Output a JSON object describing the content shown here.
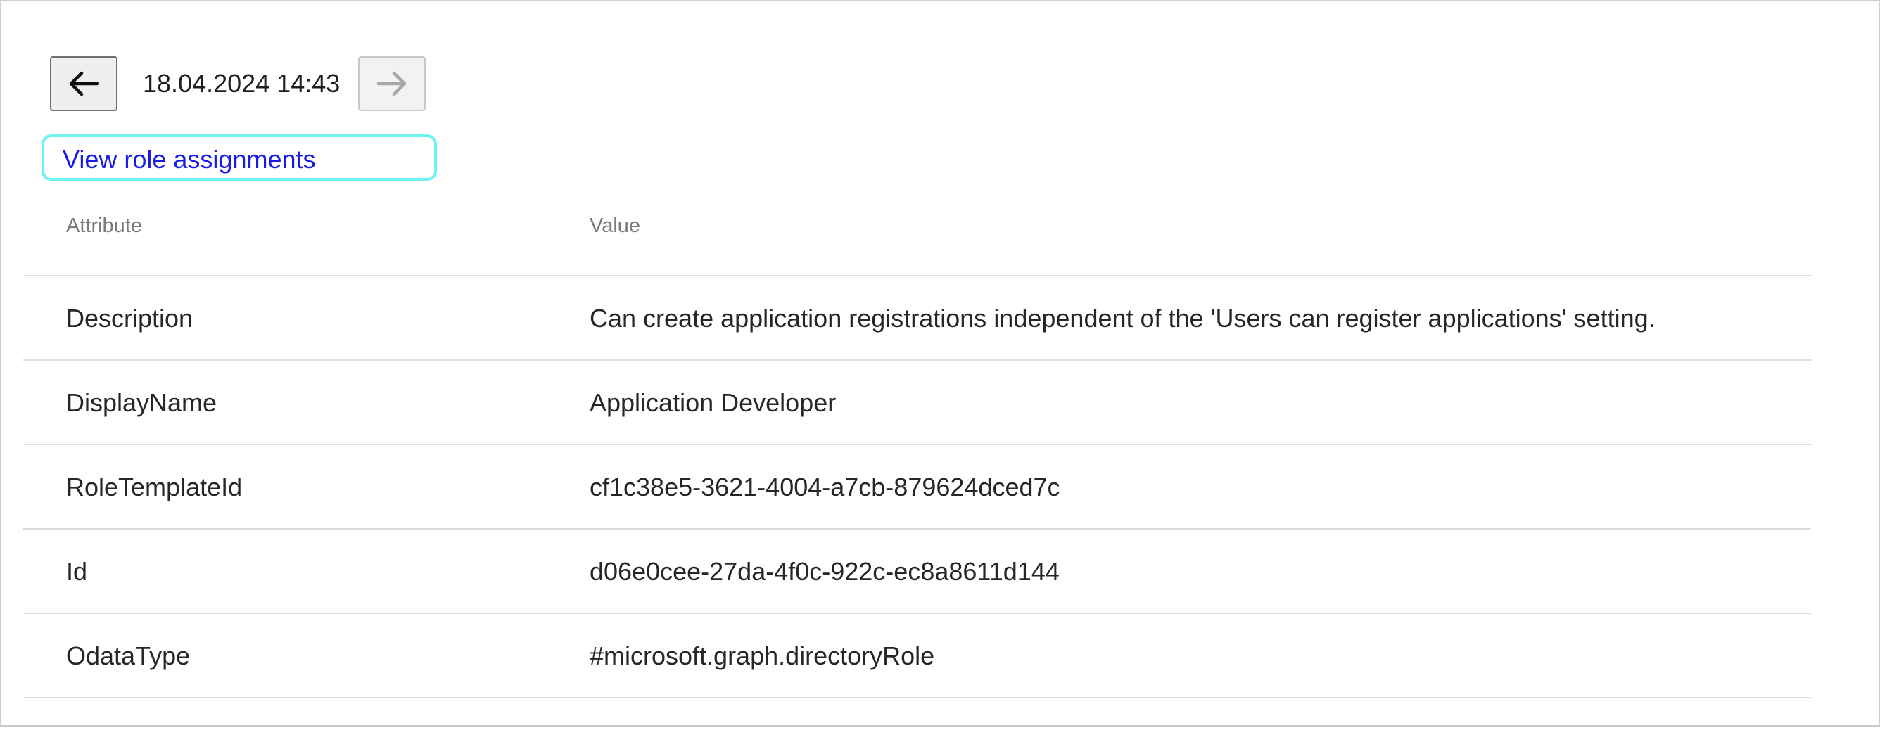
{
  "nav": {
    "timestamp": "18.04.2024 14:43",
    "prev_icon": "arrow-left-icon",
    "next_icon": "arrow-right-icon"
  },
  "role_link": {
    "label": "View role assignments"
  },
  "table": {
    "headers": {
      "attribute": "Attribute",
      "value": "Value"
    },
    "rows": [
      {
        "attribute": "Description",
        "value": "Can create application registrations independent of the 'Users can register applications' setting."
      },
      {
        "attribute": "DisplayName",
        "value": "Application Developer"
      },
      {
        "attribute": "RoleTemplateId",
        "value": "cf1c38e5-3621-4004-a7cb-879624dced7c"
      },
      {
        "attribute": "Id",
        "value": "d06e0cee-27da-4f0c-922c-ec8a8611d144"
      },
      {
        "attribute": "OdataType",
        "value": "#microsoft.graph.directoryRole"
      }
    ]
  },
  "colors": {
    "link": "#1a1ae6",
    "focus_outline": "#6ff2f2",
    "header_text": "#7a7a7a",
    "divider": "#dddddd"
  }
}
